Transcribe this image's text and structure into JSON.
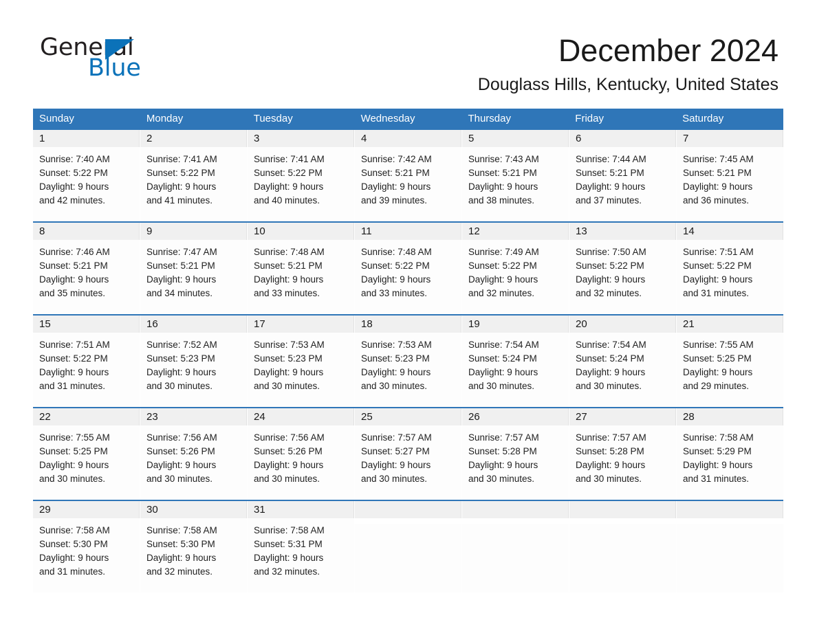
{
  "brand": {
    "logo_text_1": "General",
    "logo_text_2": "Blue",
    "triangle_icon": "triangle-icon",
    "accent_color": "#0b72b9"
  },
  "header": {
    "month_title": "December 2024",
    "location": "Douglass Hills, Kentucky, United States"
  },
  "calendar": {
    "header_color": "#2f76b8",
    "daynum_band_color": "#f0f0f0",
    "weekday_headers": [
      "Sunday",
      "Monday",
      "Tuesday",
      "Wednesday",
      "Thursday",
      "Friday",
      "Saturday"
    ],
    "weeks": [
      [
        {
          "day": "1",
          "sunrise": "Sunrise: 7:40 AM",
          "sunset": "Sunset: 5:22 PM",
          "daylight_1": "Daylight: 9 hours",
          "daylight_2": "and 42 minutes."
        },
        {
          "day": "2",
          "sunrise": "Sunrise: 7:41 AM",
          "sunset": "Sunset: 5:22 PM",
          "daylight_1": "Daylight: 9 hours",
          "daylight_2": "and 41 minutes."
        },
        {
          "day": "3",
          "sunrise": "Sunrise: 7:41 AM",
          "sunset": "Sunset: 5:22 PM",
          "daylight_1": "Daylight: 9 hours",
          "daylight_2": "and 40 minutes."
        },
        {
          "day": "4",
          "sunrise": "Sunrise: 7:42 AM",
          "sunset": "Sunset: 5:21 PM",
          "daylight_1": "Daylight: 9 hours",
          "daylight_2": "and 39 minutes."
        },
        {
          "day": "5",
          "sunrise": "Sunrise: 7:43 AM",
          "sunset": "Sunset: 5:21 PM",
          "daylight_1": "Daylight: 9 hours",
          "daylight_2": "and 38 minutes."
        },
        {
          "day": "6",
          "sunrise": "Sunrise: 7:44 AM",
          "sunset": "Sunset: 5:21 PM",
          "daylight_1": "Daylight: 9 hours",
          "daylight_2": "and 37 minutes."
        },
        {
          "day": "7",
          "sunrise": "Sunrise: 7:45 AM",
          "sunset": "Sunset: 5:21 PM",
          "daylight_1": "Daylight: 9 hours",
          "daylight_2": "and 36 minutes."
        }
      ],
      [
        {
          "day": "8",
          "sunrise": "Sunrise: 7:46 AM",
          "sunset": "Sunset: 5:21 PM",
          "daylight_1": "Daylight: 9 hours",
          "daylight_2": "and 35 minutes."
        },
        {
          "day": "9",
          "sunrise": "Sunrise: 7:47 AM",
          "sunset": "Sunset: 5:21 PM",
          "daylight_1": "Daylight: 9 hours",
          "daylight_2": "and 34 minutes."
        },
        {
          "day": "10",
          "sunrise": "Sunrise: 7:48 AM",
          "sunset": "Sunset: 5:21 PM",
          "daylight_1": "Daylight: 9 hours",
          "daylight_2": "and 33 minutes."
        },
        {
          "day": "11",
          "sunrise": "Sunrise: 7:48 AM",
          "sunset": "Sunset: 5:22 PM",
          "daylight_1": "Daylight: 9 hours",
          "daylight_2": "and 33 minutes."
        },
        {
          "day": "12",
          "sunrise": "Sunrise: 7:49 AM",
          "sunset": "Sunset: 5:22 PM",
          "daylight_1": "Daylight: 9 hours",
          "daylight_2": "and 32 minutes."
        },
        {
          "day": "13",
          "sunrise": "Sunrise: 7:50 AM",
          "sunset": "Sunset: 5:22 PM",
          "daylight_1": "Daylight: 9 hours",
          "daylight_2": "and 32 minutes."
        },
        {
          "day": "14",
          "sunrise": "Sunrise: 7:51 AM",
          "sunset": "Sunset: 5:22 PM",
          "daylight_1": "Daylight: 9 hours",
          "daylight_2": "and 31 minutes."
        }
      ],
      [
        {
          "day": "15",
          "sunrise": "Sunrise: 7:51 AM",
          "sunset": "Sunset: 5:22 PM",
          "daylight_1": "Daylight: 9 hours",
          "daylight_2": "and 31 minutes."
        },
        {
          "day": "16",
          "sunrise": "Sunrise: 7:52 AM",
          "sunset": "Sunset: 5:23 PM",
          "daylight_1": "Daylight: 9 hours",
          "daylight_2": "and 30 minutes."
        },
        {
          "day": "17",
          "sunrise": "Sunrise: 7:53 AM",
          "sunset": "Sunset: 5:23 PM",
          "daylight_1": "Daylight: 9 hours",
          "daylight_2": "and 30 minutes."
        },
        {
          "day": "18",
          "sunrise": "Sunrise: 7:53 AM",
          "sunset": "Sunset: 5:23 PM",
          "daylight_1": "Daylight: 9 hours",
          "daylight_2": "and 30 minutes."
        },
        {
          "day": "19",
          "sunrise": "Sunrise: 7:54 AM",
          "sunset": "Sunset: 5:24 PM",
          "daylight_1": "Daylight: 9 hours",
          "daylight_2": "and 30 minutes."
        },
        {
          "day": "20",
          "sunrise": "Sunrise: 7:54 AM",
          "sunset": "Sunset: 5:24 PM",
          "daylight_1": "Daylight: 9 hours",
          "daylight_2": "and 30 minutes."
        },
        {
          "day": "21",
          "sunrise": "Sunrise: 7:55 AM",
          "sunset": "Sunset: 5:25 PM",
          "daylight_1": "Daylight: 9 hours",
          "daylight_2": "and 29 minutes."
        }
      ],
      [
        {
          "day": "22",
          "sunrise": "Sunrise: 7:55 AM",
          "sunset": "Sunset: 5:25 PM",
          "daylight_1": "Daylight: 9 hours",
          "daylight_2": "and 30 minutes."
        },
        {
          "day": "23",
          "sunrise": "Sunrise: 7:56 AM",
          "sunset": "Sunset: 5:26 PM",
          "daylight_1": "Daylight: 9 hours",
          "daylight_2": "and 30 minutes."
        },
        {
          "day": "24",
          "sunrise": "Sunrise: 7:56 AM",
          "sunset": "Sunset: 5:26 PM",
          "daylight_1": "Daylight: 9 hours",
          "daylight_2": "and 30 minutes."
        },
        {
          "day": "25",
          "sunrise": "Sunrise: 7:57 AM",
          "sunset": "Sunset: 5:27 PM",
          "daylight_1": "Daylight: 9 hours",
          "daylight_2": "and 30 minutes."
        },
        {
          "day": "26",
          "sunrise": "Sunrise: 7:57 AM",
          "sunset": "Sunset: 5:28 PM",
          "daylight_1": "Daylight: 9 hours",
          "daylight_2": "and 30 minutes."
        },
        {
          "day": "27",
          "sunrise": "Sunrise: 7:57 AM",
          "sunset": "Sunset: 5:28 PM",
          "daylight_1": "Daylight: 9 hours",
          "daylight_2": "and 30 minutes."
        },
        {
          "day": "28",
          "sunrise": "Sunrise: 7:58 AM",
          "sunset": "Sunset: 5:29 PM",
          "daylight_1": "Daylight: 9 hours",
          "daylight_2": "and 31 minutes."
        }
      ],
      [
        {
          "day": "29",
          "sunrise": "Sunrise: 7:58 AM",
          "sunset": "Sunset: 5:30 PM",
          "daylight_1": "Daylight: 9 hours",
          "daylight_2": "and 31 minutes."
        },
        {
          "day": "30",
          "sunrise": "Sunrise: 7:58 AM",
          "sunset": "Sunset: 5:30 PM",
          "daylight_1": "Daylight: 9 hours",
          "daylight_2": "and 32 minutes."
        },
        {
          "day": "31",
          "sunrise": "Sunrise: 7:58 AM",
          "sunset": "Sunset: 5:31 PM",
          "daylight_1": "Daylight: 9 hours",
          "daylight_2": "and 32 minutes."
        },
        {
          "day": "",
          "sunrise": "",
          "sunset": "",
          "daylight_1": "",
          "daylight_2": ""
        },
        {
          "day": "",
          "sunrise": "",
          "sunset": "",
          "daylight_1": "",
          "daylight_2": ""
        },
        {
          "day": "",
          "sunrise": "",
          "sunset": "",
          "daylight_1": "",
          "daylight_2": ""
        },
        {
          "day": "",
          "sunrise": "",
          "sunset": "",
          "daylight_1": "",
          "daylight_2": ""
        }
      ]
    ]
  }
}
